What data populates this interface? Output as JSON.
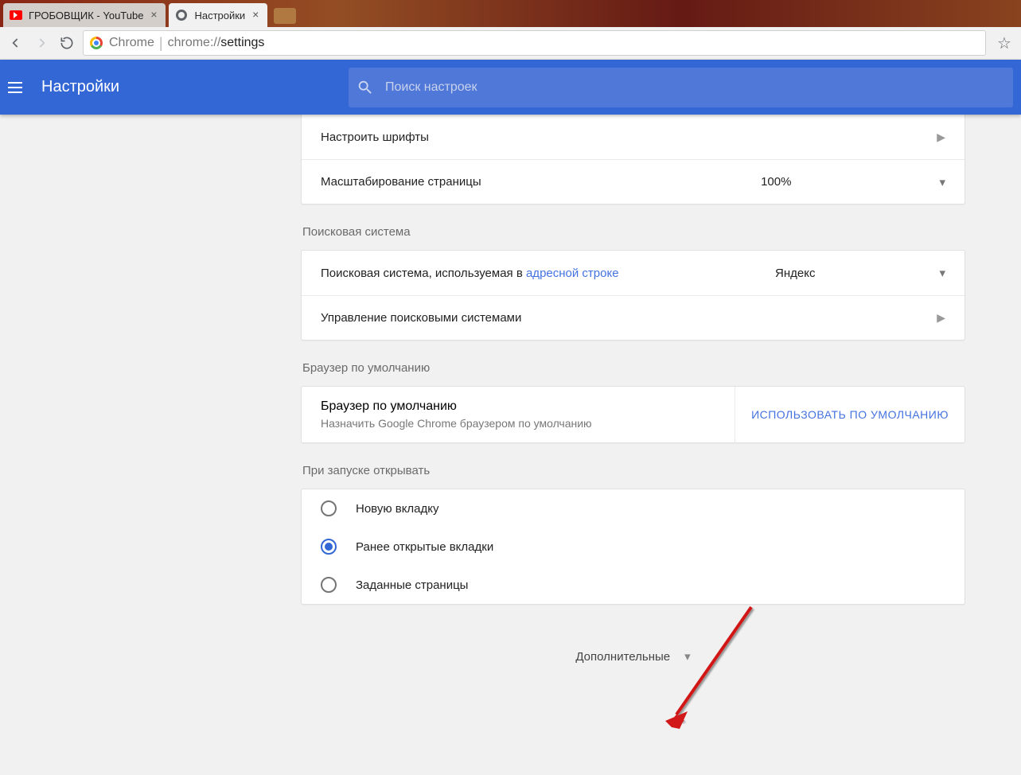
{
  "browser": {
    "tabs": [
      {
        "title": "ГРОБОВЩИК - YouTube",
        "active": false
      },
      {
        "title": "Настройки",
        "active": true
      }
    ],
    "omnibox": {
      "origin_label": "Chrome",
      "url_prefix": "chrome://",
      "url_path": "settings"
    }
  },
  "header": {
    "title": "Настройки",
    "search_placeholder": "Поиск настроек"
  },
  "appearance": {
    "customize_fonts": "Настроить шрифты",
    "page_zoom_label": "Масштабирование страницы",
    "page_zoom_value": "100%"
  },
  "search_engine": {
    "section_title": "Поисковая система",
    "used_in_label": "Поисковая система, используемая в ",
    "address_bar_link": "адресной строке",
    "selected_engine": "Яндекс",
    "manage_label": "Управление поисковыми системами"
  },
  "default_browser": {
    "section_title": "Браузер по умолчанию",
    "row_title": "Браузер по умолчанию",
    "row_subtitle": "Назначить Google Chrome браузером по умолчанию",
    "button_label": "ИСПОЛЬЗОВАТЬ ПО УМОЛЧАНИЮ"
  },
  "on_startup": {
    "section_title": "При запуске открывать",
    "options": [
      {
        "label": "Новую вкладку",
        "selected": false
      },
      {
        "label": "Ранее открытые вкладки",
        "selected": true
      },
      {
        "label": "Заданные страницы",
        "selected": false
      }
    ]
  },
  "advanced_label": "Дополнительные"
}
